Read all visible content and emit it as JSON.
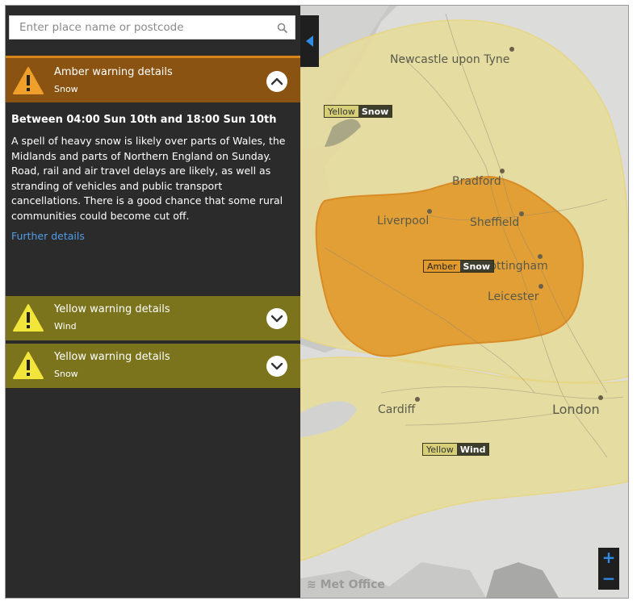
{
  "search": {
    "placeholder": "Enter place name or postcode",
    "icon": "search-icon"
  },
  "panel": {
    "amber": {
      "title": "Amber warning details",
      "type": "Snow",
      "expanded": true,
      "period": "Between 04:00 Sun 10th and 18:00 Sun 10th",
      "description": "A spell of heavy snow is likely over parts of Wales, the Midlands and parts of Northern England on Sunday. Road, rail and air travel delays are likely, as well as stranding of vehicles and public transport cancellations. There is a good chance that some rural communities could become cut off.",
      "link": "Further details"
    },
    "wind": {
      "title": "Yellow warning details",
      "type": "Wind"
    },
    "snow": {
      "title": "Yellow warning details",
      "type": "Snow"
    }
  },
  "map": {
    "cities": {
      "newcastle": "Newcastle upon Tyne",
      "bradford": "Bradford",
      "liverpool": "Liverpool",
      "sheffield": "Sheffield",
      "nottingham": "Nottingham",
      "leicester": "Leicester",
      "cardiff": "Cardiff",
      "london": "London"
    },
    "badges": {
      "yellow_snow": {
        "level": "Yellow",
        "type": "Snow"
      },
      "amber_snow": {
        "level": "Amber",
        "type": "Snow"
      },
      "yellow_wind": {
        "level": "Yellow",
        "type": "Wind"
      }
    },
    "logo": "Met Office",
    "zoom_in": "+",
    "zoom_out": "−"
  },
  "colors": {
    "amber_header": "#8b5311",
    "yellow_header": "#7b741d",
    "amber_area": "#e29a2c",
    "yellow_area": "#e6dca0",
    "link": "#4f9de8",
    "accent": "#2e8ce6"
  }
}
